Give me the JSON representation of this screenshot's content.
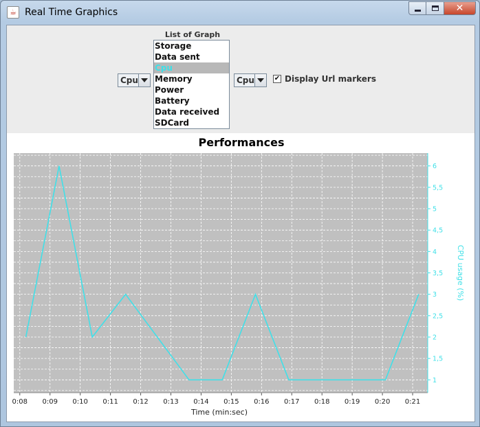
{
  "window": {
    "title": "Real Time Graphics",
    "icon": "java-cup-icon"
  },
  "controls": {
    "list_caption": "List of Graph",
    "graph_list": [
      "Storage",
      "Data sent",
      "Cpu",
      "Memory",
      "Power",
      "Battery",
      "Data received",
      "SDCard"
    ],
    "graph_list_selected": "Cpu",
    "left_combo_value": "Cpu",
    "right_combo_value": "Cpu",
    "display_url_markers_label": "Display Url markers",
    "display_url_markers_checked": true
  },
  "colors": {
    "series": "#40e0e8",
    "plot_background": "#c0c0c0",
    "selected_item_text": "#3ee0e8"
  },
  "chart_data": {
    "type": "line",
    "title": "Performances",
    "xlabel": "Time (min:sec)",
    "ylabel": "CPU usage (%)",
    "x_ticks": [
      "0:08",
      "0:09",
      "0:10",
      "0:11",
      "0:12",
      "0:13",
      "0:14",
      "0:15",
      "0:16",
      "0:17",
      "0:18",
      "0:19",
      "0:20",
      "0:21"
    ],
    "y_ticks": [
      "1",
      "1,5",
      "2",
      "2,5",
      "3",
      "3,5",
      "4",
      "4,5",
      "5",
      "5,5",
      "6"
    ],
    "xlim": [
      "0:07.8",
      "0:21.5"
    ],
    "ylim": [
      0.7,
      6.3
    ],
    "y_axis_side": "right",
    "grid": true,
    "series": [
      {
        "x": [
          "0:08.2",
          "0:09.3",
          "0:10.4",
          "0:11.5",
          "0:13.6",
          "0:14.7",
          "0:15.8",
          "0:16.9",
          "0:20.1",
          "0:21.2"
        ],
        "y": [
          2,
          6,
          2,
          3,
          1,
          1,
          3,
          1,
          1,
          3
        ]
      }
    ]
  }
}
